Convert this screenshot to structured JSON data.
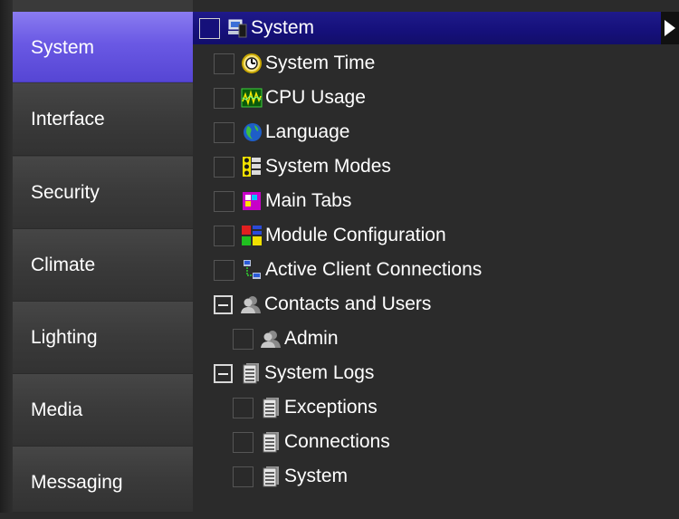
{
  "sidebar": {
    "items": [
      {
        "label": "System",
        "active": true
      },
      {
        "label": "Interface",
        "active": false
      },
      {
        "label": "Security",
        "active": false
      },
      {
        "label": "Climate",
        "active": false
      },
      {
        "label": "Lighting",
        "active": false
      },
      {
        "label": "Media",
        "active": false
      },
      {
        "label": "Messaging",
        "active": false
      }
    ]
  },
  "tree": {
    "header": {
      "label": "System",
      "icon": "computer-icon"
    },
    "items": [
      {
        "label": "System Time",
        "icon": "clock-icon"
      },
      {
        "label": "CPU Usage",
        "icon": "cpu-graph-icon"
      },
      {
        "label": "Language",
        "icon": "globe-icon"
      },
      {
        "label": "System Modes",
        "icon": "modes-icon"
      },
      {
        "label": "Main Tabs",
        "icon": "tabs-icon"
      },
      {
        "label": "Module Configuration",
        "icon": "module-config-icon"
      },
      {
        "label": "Active Client Connections",
        "icon": "network-icon"
      },
      {
        "label": "Contacts and Users",
        "icon": "users-icon"
      },
      {
        "label": "Admin",
        "icon": "user-icon"
      },
      {
        "label": "System Logs",
        "icon": "log-icon"
      },
      {
        "label": "Exceptions",
        "icon": "log-icon"
      },
      {
        "label": "Connections",
        "icon": "log-icon"
      },
      {
        "label": "System",
        "icon": "log-icon"
      }
    ]
  },
  "colors": {
    "active_tab": "#6a59e4",
    "header_bar": "#15107a",
    "background": "#2b2b2b",
    "sidebar": "#3a3a3a"
  }
}
